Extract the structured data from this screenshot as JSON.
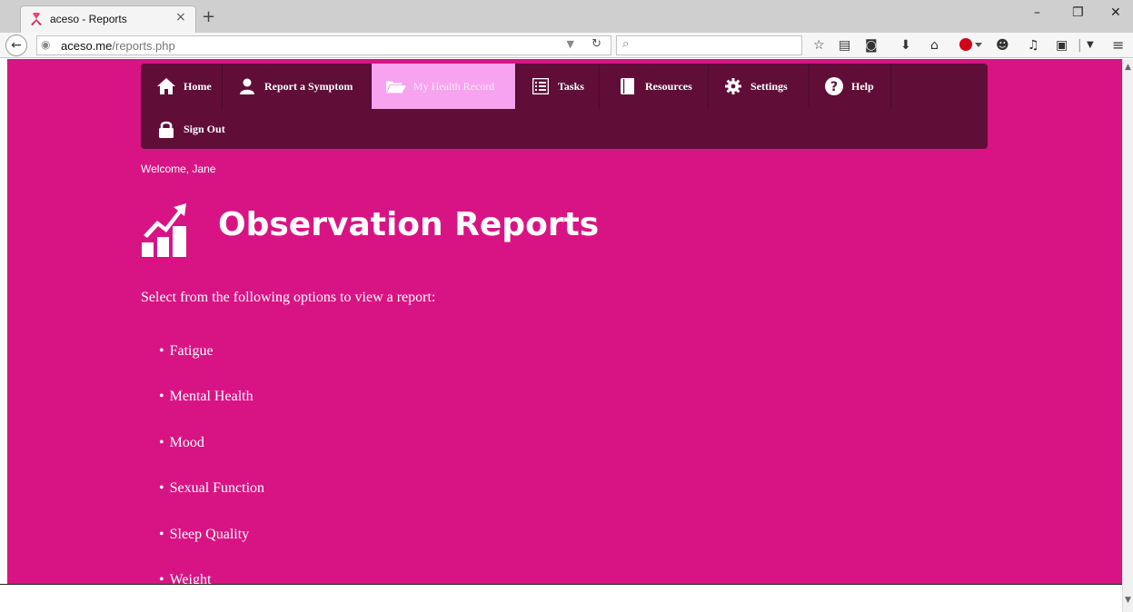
{
  "browser": {
    "tab_title": "aceso - Reports",
    "tab_close": "×",
    "new_tab": "+",
    "url_domain": "aceso.me",
    "url_path": "/reports.php",
    "window_controls": [
      "–",
      "❐",
      "✕"
    ]
  },
  "menu": {
    "items": [
      {
        "label": "Home",
        "icon": "home-icon"
      },
      {
        "label": "Report a Symptom",
        "icon": "user-icon"
      },
      {
        "label": "My Health Record",
        "icon": "folder-open-icon",
        "active": true
      },
      {
        "label": "Tasks",
        "icon": "list-icon"
      },
      {
        "label": "Resources",
        "icon": "book-icon"
      },
      {
        "label": "Settings",
        "icon": "gear-icon"
      },
      {
        "label": "Help",
        "icon": "question-circle-icon"
      },
      {
        "label": "Sign Out",
        "icon": "lock-icon"
      }
    ]
  },
  "welcome": "Welcome, Jane",
  "heading": "Observation Reports",
  "heading_icon": "trending-up-chart-icon",
  "intro": "Select from the following options to view a report:",
  "options": [
    "Fatigue",
    "Mental Health",
    "Mood",
    "Sexual Function",
    "Sleep Quality",
    "Weight"
  ],
  "colors": {
    "page_background": "#d81484",
    "menu_background": "#600e37",
    "menu_active": "#f7a3ef",
    "text": "#ffffff"
  }
}
